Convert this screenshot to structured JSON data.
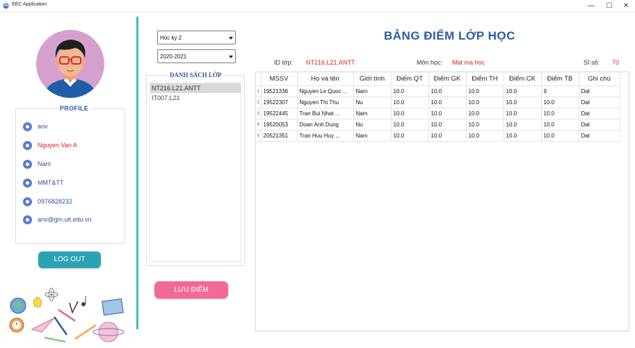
{
  "window": {
    "title": "EEC Application",
    "min_glyph": "—",
    "max_glyph": "☐",
    "close_glyph": "✕"
  },
  "profile": {
    "title": "PROFILE",
    "username": "anv",
    "fullname": "Nguyen Van A",
    "gender": "Nam",
    "department": "MMT&TT",
    "phone": "0976828232",
    "email": "anv@gm.uit.edu.vn"
  },
  "logout_label": "LOG OUT",
  "semester": {
    "selected": "Hoc ky 2"
  },
  "year": {
    "selected": "2020-2021"
  },
  "class_list": {
    "title": "DANH SÁCH LỚP",
    "items": [
      "NT216.L21.ANTT",
      "IT007.L21"
    ]
  },
  "save_label": "LƯU ĐIỂM",
  "main": {
    "title": "BẢNG ĐIỂM LỚP HỌC",
    "id_label": "ID lớp:",
    "id_value": "NT216.L21.ANTT",
    "subject_label": "Môn học:",
    "subject_value": "Mat ma hoc",
    "count_label": "Sĩ số:",
    "count_value": "70"
  },
  "table": {
    "headers": [
      "MSSV",
      "Họ và tên",
      "Giới tính",
      "Điểm QT",
      "Điểm GK",
      "Điểm TH",
      "Điểm CK",
      "Điểm TB",
      "Ghi chú"
    ],
    "rows": [
      [
        "1",
        "19521336",
        "Nguyen Le Quoc ...",
        "Nam",
        "10.0",
        "10.0",
        "10.0",
        "10.0",
        "9",
        "Dat"
      ],
      [
        "2",
        "19522307",
        "Nguyen Thi Thu",
        "Nu",
        "10.0",
        "10.0",
        "10.0",
        "10.0",
        "10.0",
        "Dat"
      ],
      [
        "3",
        "19522445",
        "Tran Bui Nhat ...",
        "Nam",
        "10.0",
        "10.0",
        "10.0",
        "10.0",
        "10.0",
        "Dat"
      ],
      [
        "4",
        "19520053",
        "Doan Anh Dung",
        "Nu",
        "10.0",
        "10.0",
        "10.0",
        "10.0",
        "10.0",
        "Dat"
      ],
      [
        "5",
        "20521351",
        "Tran Huu Huy ...",
        "Nam",
        "10.0",
        "10.0",
        "10.0",
        "10.0",
        "10.0",
        "Dat"
      ]
    ]
  },
  "colors": {
    "accent_blue": "#2d5aa0",
    "teal": "#3dbfc4",
    "pink": "#f26996",
    "red_value": "#e02020"
  }
}
